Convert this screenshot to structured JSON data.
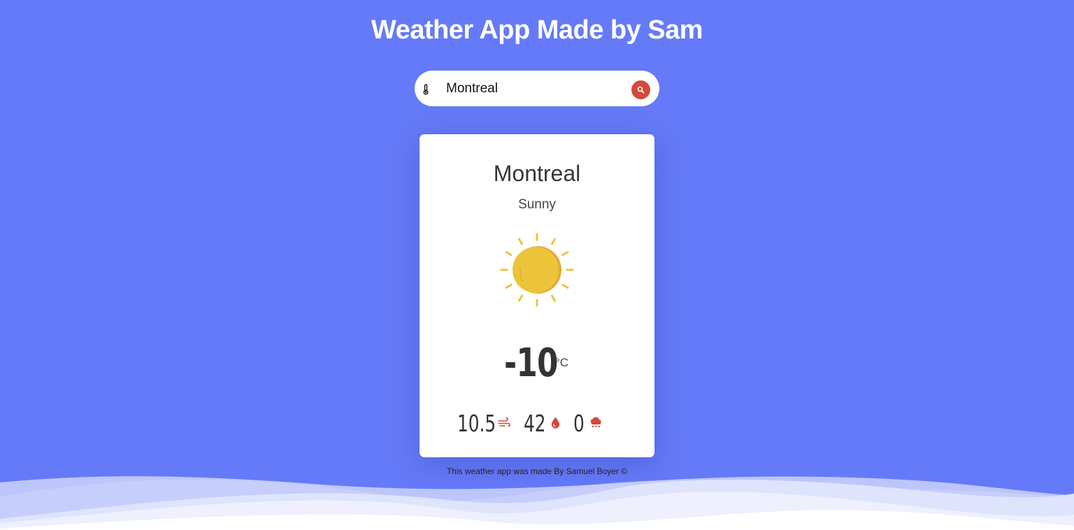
{
  "header": {
    "title": "Weather App Made by Sam"
  },
  "search": {
    "value": "Montreal",
    "icon": "thermometer-icon",
    "button_icon": "search-icon"
  },
  "weather": {
    "city": "Montreal",
    "condition": "Sunny",
    "condition_icon": "sun-icon",
    "temperature": "-10",
    "unit": "°C",
    "wind": "10.5",
    "wind_icon": "wind-icon",
    "humidity": "42",
    "humidity_icon": "droplet-icon",
    "precipitation": "0",
    "precipitation_icon": "rain-cloud-icon"
  },
  "footer": {
    "text": "This weather app was made By Samuel Boyer ©"
  },
  "colors": {
    "background": "#657af8",
    "accent": "#d34a3c",
    "sun": "#ecc43a",
    "sun_shade": "#e6a83a"
  }
}
